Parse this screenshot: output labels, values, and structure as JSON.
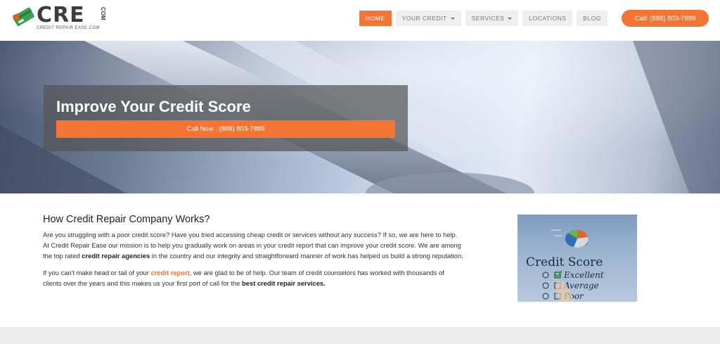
{
  "logo": {
    "wordmark": "CRE",
    "suffix": "COM",
    "tagline": "CREDIT REPAIR EASE.COM"
  },
  "nav": {
    "items": [
      {
        "label": "HOME",
        "active": true,
        "has_caret": false
      },
      {
        "label": "YOUR CREDIT",
        "active": false,
        "has_caret": true
      },
      {
        "label": "SERVICES",
        "active": false,
        "has_caret": true
      },
      {
        "label": "LOCATIONS",
        "active": false,
        "has_caret": false
      },
      {
        "label": "BLOG",
        "active": false,
        "has_caret": false
      }
    ],
    "call_button": "Call: (888) 803-7889"
  },
  "hero": {
    "title": "Improve Your Credit Score",
    "button": "Call Now : (888) 803-7889"
  },
  "main": {
    "heading": "How Credit Repair Company Works?",
    "para1": {
      "before": "Are you struggling with a poor credit score? Have you tried accessing cheap credit or services without any success? If so, we are here to help. At Credit Repair Ease our mission is to help you gradually work on areas in your credit report that can improve your credit score. We are among the top rated ",
      "bold": "credit repair agencies",
      "after": " in the country and our integrity and straightforward manner of work has helped us build a strong reputation."
    },
    "para2": {
      "before": "If you can't make head or tail of your ",
      "link": "credit report",
      "middle": ", we are glad to be of help. Our team of credit counselors has worked with thousands of clients over the years and this makes us your first port of call for the ",
      "bold": "best credit repair services."
    }
  },
  "image": {
    "title": "Credit Score",
    "options": [
      "Excellent",
      "Average",
      "Poor"
    ]
  },
  "colors": {
    "accent": "#f47435",
    "logo_green": "#3aa14a",
    "nav_bg": "#efefef"
  }
}
